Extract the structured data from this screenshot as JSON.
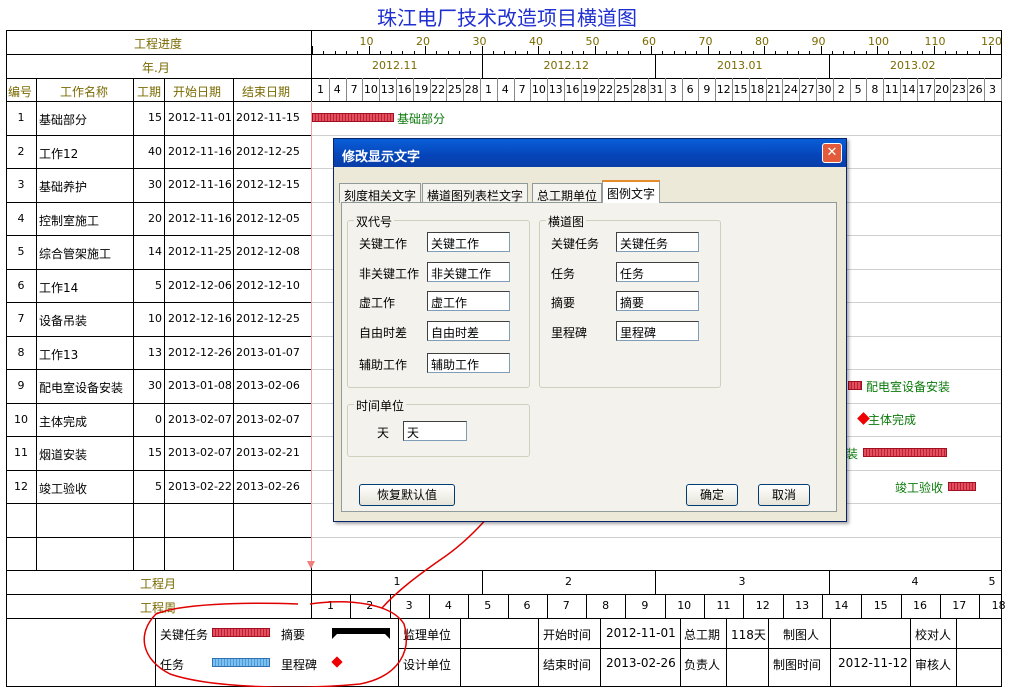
{
  "title": "珠江电厂技术改造项目横道图",
  "header": {
    "progress_label": "工程进度",
    "month_label": "年.月",
    "progress_ticks": [
      "10",
      "20",
      "30",
      "40",
      "50",
      "60",
      "70",
      "80",
      "90",
      "100",
      "110",
      "120"
    ],
    "months": [
      "2012.11",
      "2012.12",
      "2013.01",
      "2013.02"
    ],
    "days": [
      "1",
      "4",
      "7",
      "10",
      "13",
      "16",
      "19",
      "22",
      "25",
      "28",
      "1",
      "4",
      "7",
      "10",
      "13",
      "16",
      "19",
      "22",
      "25",
      "28",
      "31",
      "3",
      "6",
      "9",
      "12",
      "15",
      "18",
      "21",
      "24",
      "27",
      "30",
      "2",
      "5",
      "8",
      "11",
      "14",
      "17",
      "20",
      "23",
      "26",
      "3"
    ]
  },
  "columns": {
    "num": "编号",
    "name": "工作名称",
    "dur": "工期",
    "start": "开始日期",
    "end": "结束日期"
  },
  "tasks": [
    {
      "num": "1",
      "name": "基础部分",
      "dur": "15",
      "start": "2012-11-01",
      "end": "2012-11-15"
    },
    {
      "num": "2",
      "name": "工作12",
      "dur": "40",
      "start": "2012-11-16",
      "end": "2012-12-25"
    },
    {
      "num": "3",
      "name": "基础养护",
      "dur": "30",
      "start": "2012-11-16",
      "end": "2012-12-15"
    },
    {
      "num": "4",
      "name": "控制室施工",
      "dur": "20",
      "start": "2012-11-16",
      "end": "2012-12-05"
    },
    {
      "num": "5",
      "name": "综合管架施工",
      "dur": "14",
      "start": "2012-11-25",
      "end": "2012-12-08"
    },
    {
      "num": "6",
      "name": "工作14",
      "dur": "5",
      "start": "2012-12-06",
      "end": "2012-12-10"
    },
    {
      "num": "7",
      "name": "设备吊装",
      "dur": "10",
      "start": "2012-12-16",
      "end": "2012-12-25"
    },
    {
      "num": "8",
      "name": "工作13",
      "dur": "13",
      "start": "2012-12-26",
      "end": "2013-01-07"
    },
    {
      "num": "9",
      "name": "配电室设备安装",
      "dur": "30",
      "start": "2013-01-08",
      "end": "2013-02-06"
    },
    {
      "num": "10",
      "name": "主体完成",
      "dur": "0",
      "start": "2013-02-07",
      "end": "2013-02-07"
    },
    {
      "num": "11",
      "name": "烟道安装",
      "dur": "15",
      "start": "2013-02-07",
      "end": "2013-02-21"
    },
    {
      "num": "12",
      "name": "竣工验收",
      "dur": "5",
      "start": "2013-02-22",
      "end": "2013-02-26"
    }
  ],
  "chart_labels": {
    "t1": "基础部分",
    "t9": "配电室设备安装",
    "t10": "主体完成",
    "t11": "装",
    "t12": "竣工验收"
  },
  "footer": {
    "month_label": "工程月",
    "week_label": "工程周",
    "months": [
      "1",
      "2",
      "3",
      "4",
      "5"
    ],
    "weeks": [
      "1",
      "2",
      "3",
      "4",
      "5",
      "6",
      "7",
      "8",
      "9",
      "10",
      "11",
      "12",
      "13",
      "14",
      "15",
      "16",
      "17",
      "18"
    ],
    "legend": {
      "key": "关键任务",
      "summary": "摘要",
      "task": "任务",
      "milestone": "里程碑"
    },
    "info": {
      "supervisor": "监理单位",
      "designer": "设计单位",
      "start_time": "开始时间",
      "start_val": "2012-11-01",
      "end_time": "结束时间",
      "end_val": "2013-02-26",
      "total": "总工期",
      "total_val": "118天",
      "owner": "负责人",
      "drawer": "制图人",
      "draw_time": "制图时间",
      "draw_time_val": "2012-11-12",
      "checker": "校对人",
      "reviewer": "审核人"
    }
  },
  "dialog": {
    "title": "修改显示文字",
    "tabs": [
      "刻度相关文字",
      "横道图列表栏文字",
      "总工期单位",
      "图例文字"
    ],
    "group_dual": "双代号",
    "dual": [
      {
        "label": "关键工作",
        "value": "关键工作"
      },
      {
        "label": "非关键工作",
        "value": "非关键工作"
      },
      {
        "label": "虚工作",
        "value": "虚工作"
      },
      {
        "label": "自由时差",
        "value": "自由时差"
      },
      {
        "label": "辅助工作",
        "value": "辅助工作"
      }
    ],
    "group_bar": "横道图",
    "bar": [
      {
        "label": "关键任务",
        "value": "关键任务"
      },
      {
        "label": "任务",
        "value": "任务"
      },
      {
        "label": "摘要",
        "value": "摘要"
      },
      {
        "label": "里程碑",
        "value": "里程碑"
      }
    ],
    "group_time": "时间单位",
    "time_label": "天",
    "time_value": "天",
    "restore": "恢复默认值",
    "ok": "确定",
    "cancel": "取消"
  }
}
